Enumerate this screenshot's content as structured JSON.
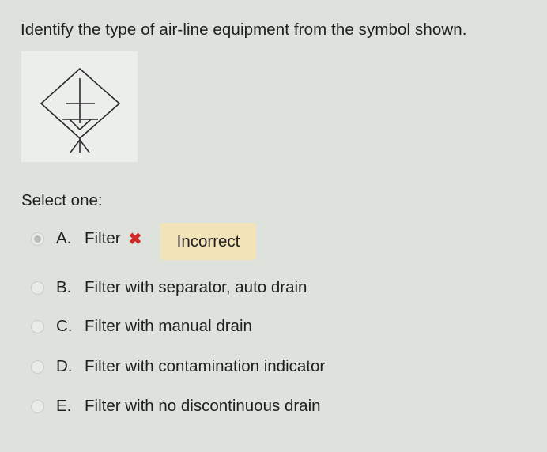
{
  "question": {
    "text": "Identify the type of air-line equipment from the symbol shown."
  },
  "symbol": {
    "icon": "filter-symbol"
  },
  "answer": {
    "prompt": "Select one:",
    "options": [
      {
        "letter": "A.",
        "label": "Filter",
        "selected": true
      },
      {
        "letter": "B.",
        "label": "Filter with separator, auto drain",
        "selected": false
      },
      {
        "letter": "C.",
        "label": "Filter with manual drain",
        "selected": false
      },
      {
        "letter": "D.",
        "label": "Filter with contamination indicator",
        "selected": false
      },
      {
        "letter": "E.",
        "label": "Filter with no discontinuous drain",
        "selected": false
      }
    ],
    "feedback": "Incorrect",
    "incorrect_mark": "✖"
  },
  "colors": {
    "background": "#dde2dd",
    "feedback_bg": "#f3e3b9",
    "incorrect": "#d12a2a"
  }
}
